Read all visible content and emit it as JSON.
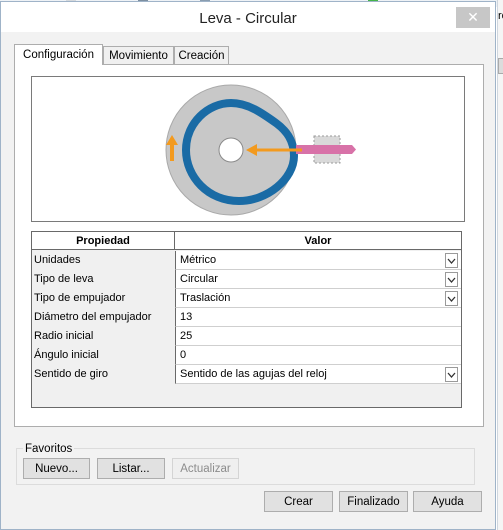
{
  "window": {
    "title": "Leva - Circular",
    "close_glyph": "✕"
  },
  "side_edge": {
    "text": "ro"
  },
  "tabs": [
    {
      "label": "Configuración",
      "active": true
    },
    {
      "label": "Movimiento",
      "active": false
    },
    {
      "label": "Creación",
      "active": false
    }
  ],
  "grid": {
    "headers": {
      "property": "Propiedad",
      "value": "Valor"
    },
    "rows": [
      {
        "label": "Unidades",
        "value": "Métrico",
        "dropdown": true
      },
      {
        "label": "Tipo de leva",
        "value": "Circular",
        "dropdown": true
      },
      {
        "label": "Tipo de empujador",
        "value": "Traslación",
        "dropdown": true
      },
      {
        "label": "Diámetro del empujador",
        "value": "13",
        "dropdown": false
      },
      {
        "label": "Radio inicial",
        "value": "25",
        "dropdown": false
      },
      {
        "label": "Ángulo inicial",
        "value": "0",
        "dropdown": false
      },
      {
        "label": "Sentido de giro",
        "value": "Sentido de las agujas del reloj",
        "dropdown": true
      }
    ]
  },
  "favorites": {
    "legend": "Favoritos",
    "buttons": {
      "new": "Nuevo...",
      "list": "Listar...",
      "update": "Actualizar"
    }
  },
  "footer": {
    "create": "Crear",
    "finish": "Finalizado",
    "help": "Ayuda"
  },
  "preview_colors": {
    "disc": "#c8c8c8",
    "cam_profile": "#1a6ba5",
    "arrow": "#f39a1e",
    "follower": "#d872a8"
  },
  "dropdown_icon": "chevron-down-icon"
}
